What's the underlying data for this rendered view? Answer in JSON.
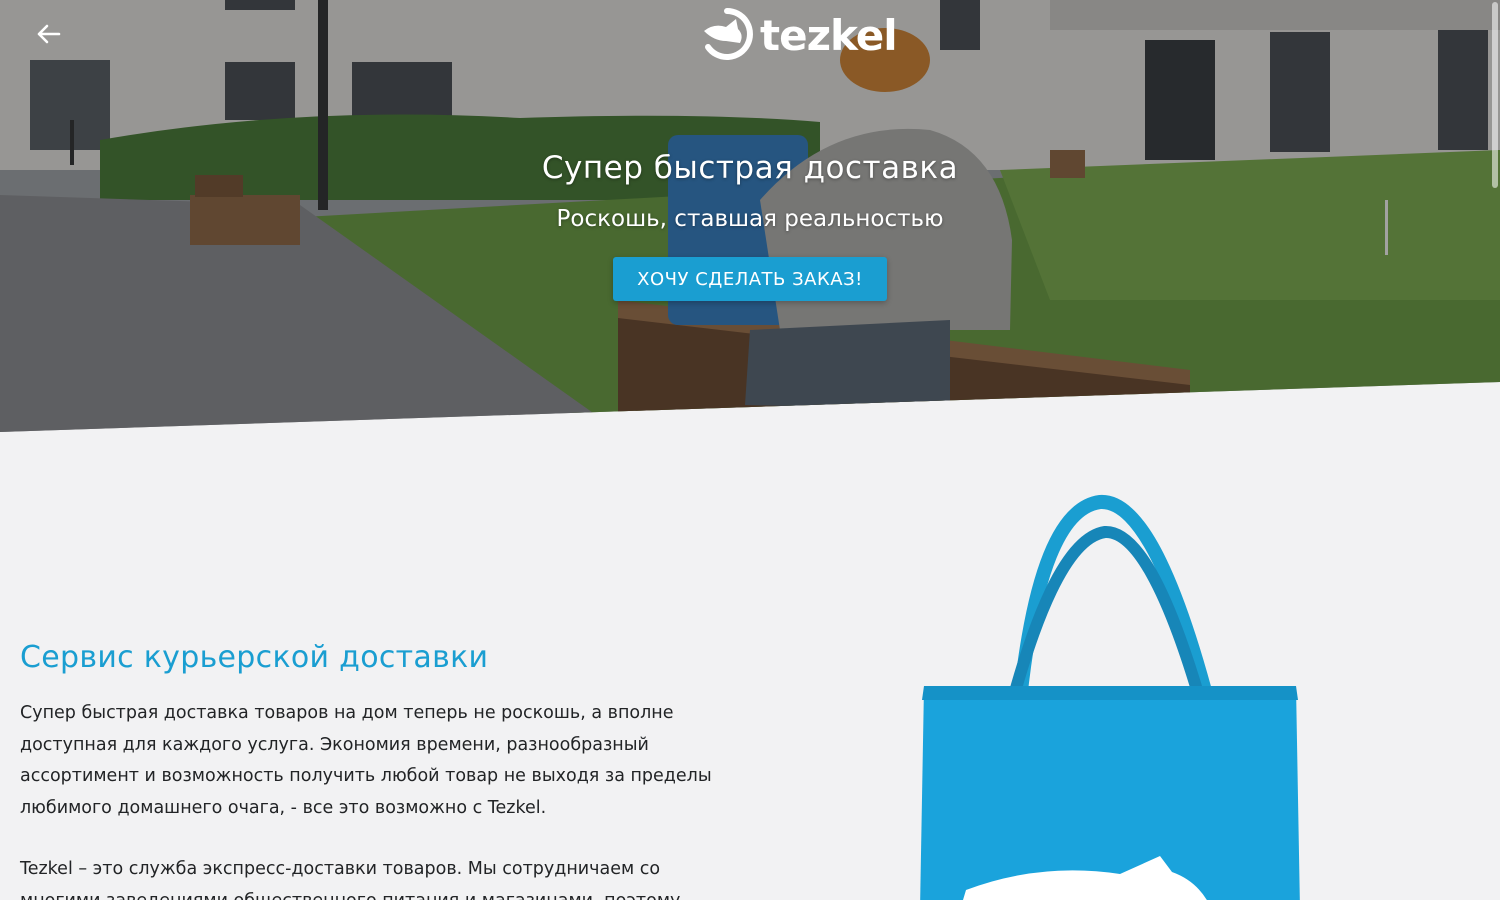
{
  "header": {
    "logo_text": "tezkel",
    "back_icon": "arrow-left-icon"
  },
  "hero": {
    "title": "Супер быстрая доставка",
    "subtitle": "Роскошь, ставшая реальностью",
    "cta_label": "ХОЧУ СДЕЛАТЬ ЗАКАЗ!"
  },
  "about": {
    "title": "Сервис курьерской доставки",
    "paragraph_1": "Супер быстрая доставка товаров на дом теперь не роскошь, а вполне доступная для каждого услуга. Экономия времени, разнообразный ассортимент и возможность получить любой товар не выходя за пределы любимого домашнего очага, - все это возможно с Tezkel.",
    "paragraph_2": "Tezkel – это служба экспресс-доставки товаров. Мы сотрудничаем со многими заведениями общественного питания и магазинами, поэтому"
  },
  "colors": {
    "accent": "#1a9ed1",
    "background": "#f2f2f3",
    "text": "#222426"
  }
}
